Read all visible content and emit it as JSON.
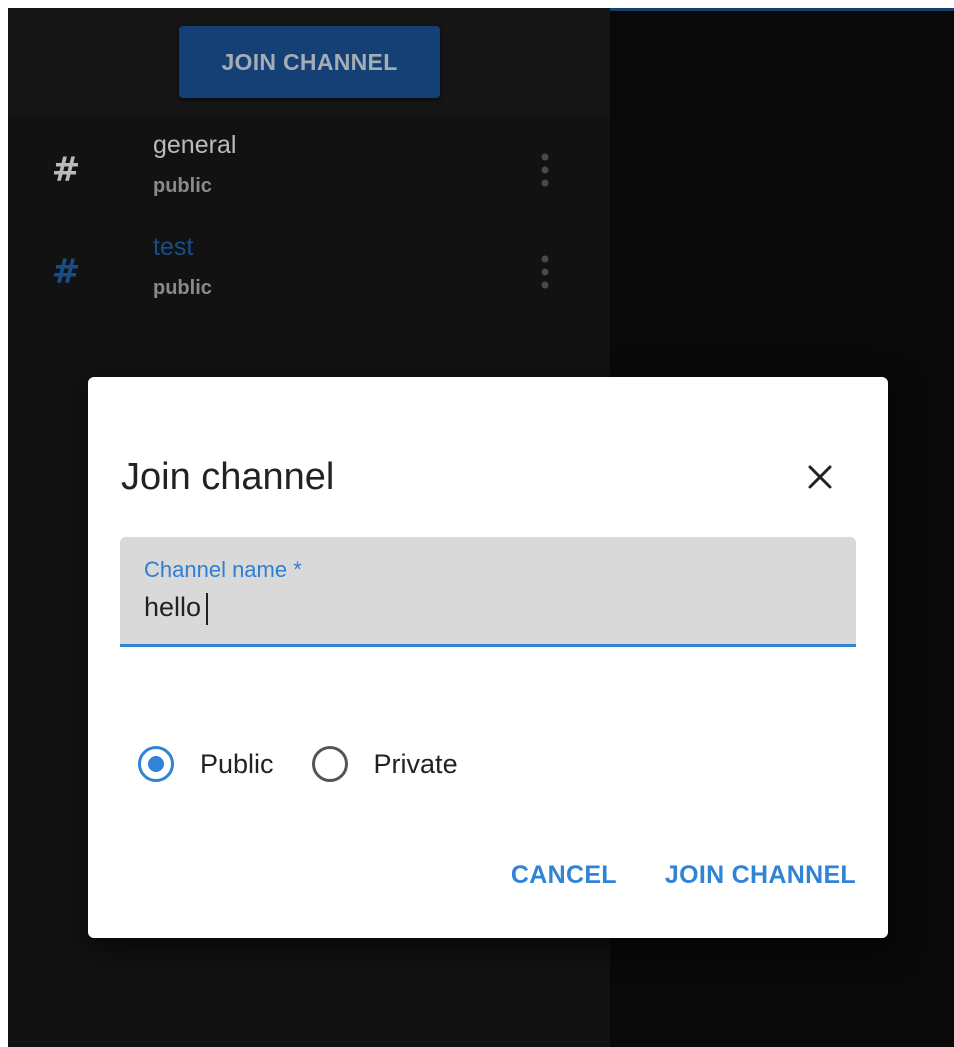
{
  "sidebar": {
    "join_button_label": "JOIN CHANNEL",
    "channels": [
      {
        "name": "general",
        "visibility": "public",
        "active": false,
        "icon": "hash-icon"
      },
      {
        "name": "test",
        "visibility": "public",
        "active": true,
        "icon": "hash-icon"
      }
    ]
  },
  "dialog": {
    "title": "Join channel",
    "close_icon": "close-icon",
    "field": {
      "label": "Channel name *",
      "value": "hello"
    },
    "radio": {
      "options": [
        {
          "label": "Public",
          "checked": true
        },
        {
          "label": "Private",
          "checked": false
        }
      ]
    },
    "actions": {
      "cancel_label": "CANCEL",
      "join_label": "JOIN CHANNEL"
    }
  },
  "colors": {
    "accent": "#2f84d6",
    "sidebar_button": "#1a4f8f",
    "active_channel": "#1d5ea8"
  }
}
